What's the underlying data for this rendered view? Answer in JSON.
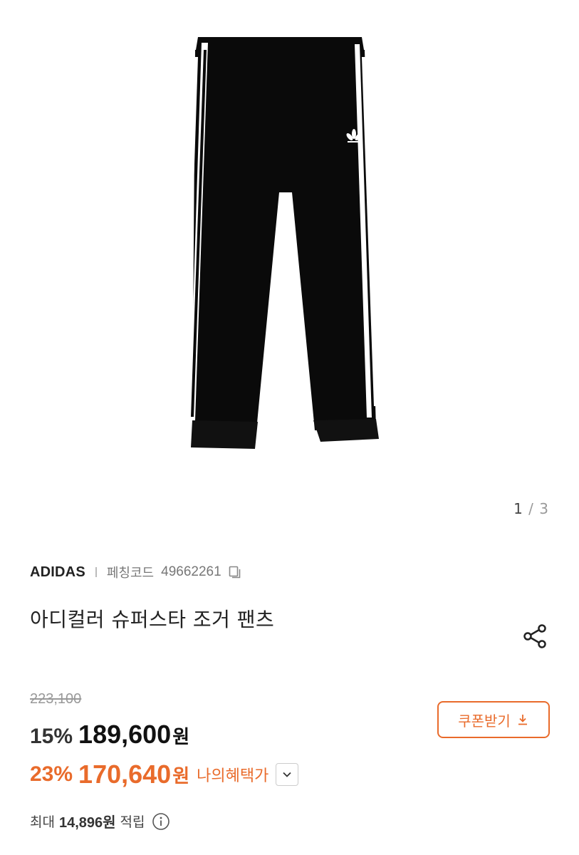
{
  "gallery": {
    "current": "1",
    "separator": "/",
    "total": "3",
    "image_icon": "pants-photo"
  },
  "product": {
    "brand": "ADIDAS",
    "code_label": "페칭코드",
    "code_value": "49662261",
    "title": "아디컬러 슈퍼스타 조거 팬츠"
  },
  "pricing": {
    "original_price": "223,100",
    "discount_pct": "15%",
    "sale_price": "189,600",
    "currency": "원",
    "benefit_pct": "23%",
    "benefit_price": "170,640",
    "benefit_label": "나의혜택가"
  },
  "coupon": {
    "label": "쿠폰받기"
  },
  "points": {
    "prefix": "최대",
    "amount": "14,896원",
    "suffix": "적립"
  },
  "colors": {
    "accent": "#e96b2b",
    "text": "#222222",
    "muted": "#999999"
  },
  "icons": [
    "copy-icon",
    "share-icon",
    "download-icon",
    "chevron-down-icon",
    "info-icon"
  ]
}
